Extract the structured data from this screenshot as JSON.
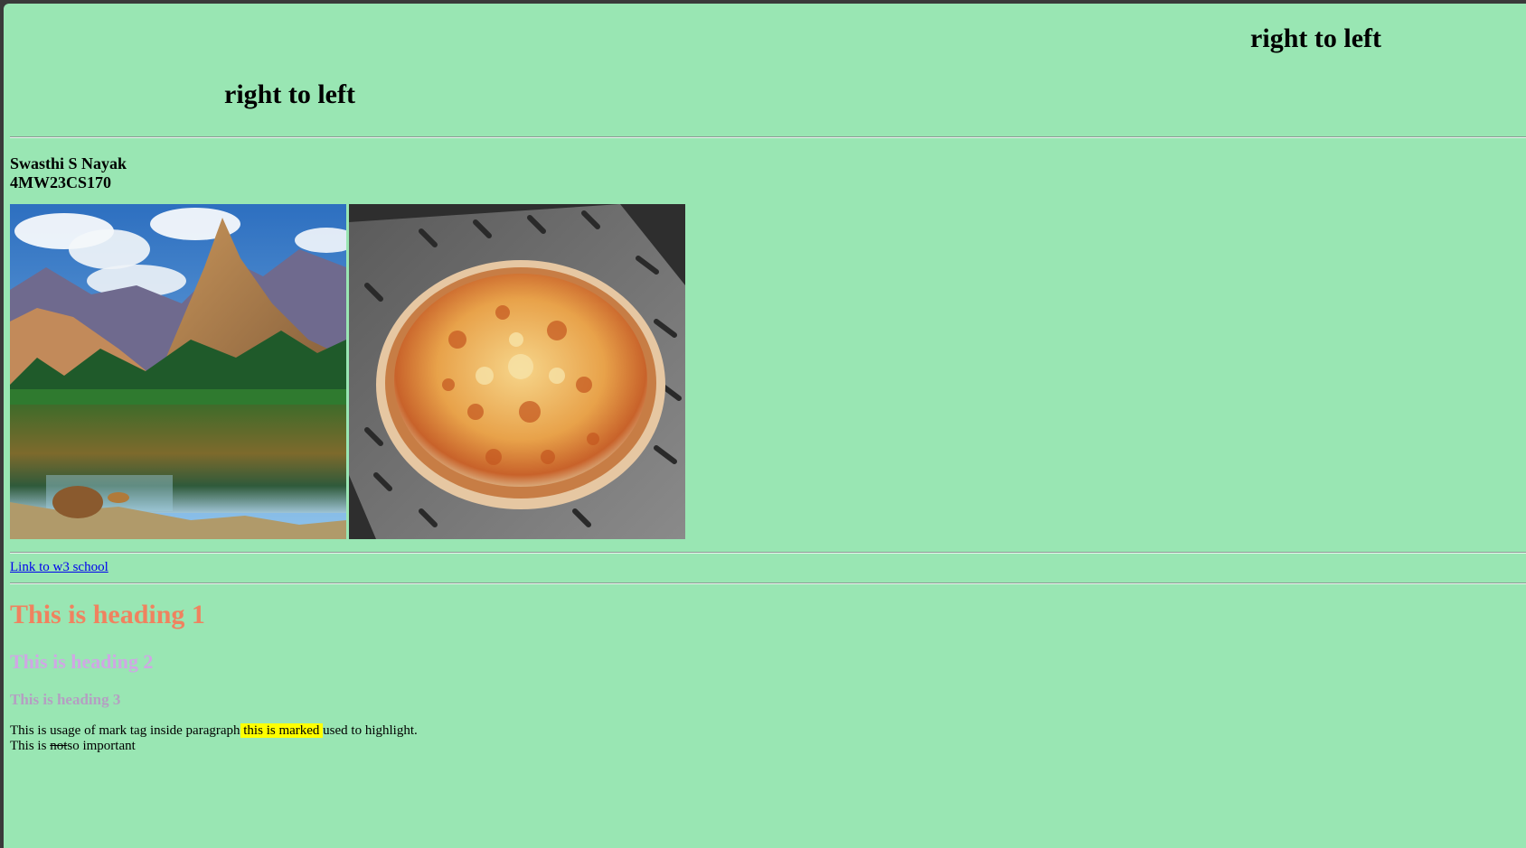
{
  "marquees": [
    "right to left",
    "right to left"
  ],
  "author": {
    "name": "Swasthi S Nayak",
    "usn": "4MW23CS170"
  },
  "images": [
    {
      "name": "mountain-lake-image",
      "alt": "Mountain lake landscape"
    },
    {
      "name": "pizza-image",
      "alt": "Cheese pizza on a perforated peel"
    }
  ],
  "link": {
    "label": "Link to w3 school"
  },
  "headings": {
    "h1": "This is heading 1",
    "h2": "This is heading 2",
    "h3": "This is heading 3"
  },
  "paragraph": {
    "line1_before": "This is usage of mark tag inside paragraph",
    "marked": " this is marked ",
    "line1_after": "used to highlight.",
    "line2_before": "This is ",
    "struck": "not",
    "line2_after": "so important"
  },
  "colors": {
    "background": "#99e6b3",
    "heading1": "#f0825f",
    "heading2": "#cfa7e4",
    "heading3": "#b49fc2",
    "link": "#0000ee",
    "mark": "#ffff00"
  }
}
